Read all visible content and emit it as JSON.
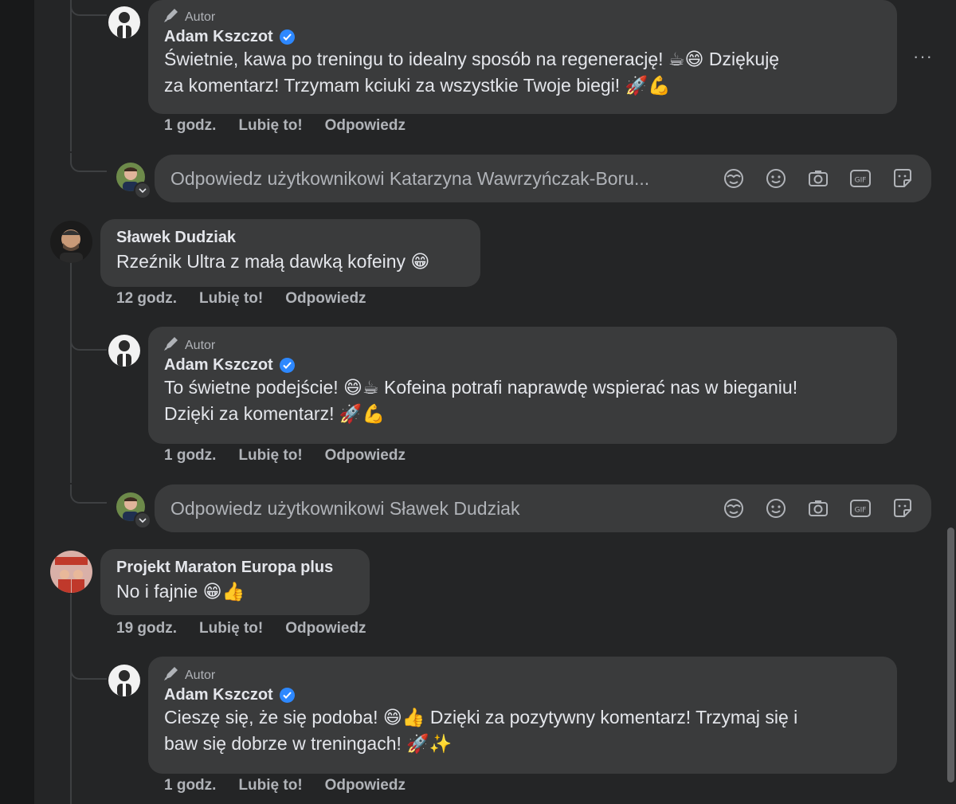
{
  "labels": {
    "author_badge": "Autor",
    "like": "Lubię to!",
    "reply": "Odpowiedz",
    "more": "···"
  },
  "thread1": {
    "reply": {
      "author": "Adam Kszczot",
      "line1": "Świetnie, kawa po treningu to idealny sposób na regenerację! ☕😄 Dziękuję",
      "line2": "za komentarz! Trzymam kciuki za wszystkie Twoje biegi! 🚀💪",
      "time": "1 godz."
    },
    "reply_box_placeholder": "Odpowiedz użytkownikowi Katarzyna Wawrzyńczak-Boru..."
  },
  "thread2": {
    "comment": {
      "author": "Sławek Dudziak",
      "text": "Rzeźnik Ultra z małą dawką kofeiny 😁",
      "time": "12 godz."
    },
    "reply": {
      "author": "Adam Kszczot",
      "line1": "To świetne podejście! 😄☕ Kofeina potrafi naprawdę wspierać nas w bieganiu!",
      "line2": "Dzięki za komentarz! 🚀💪",
      "time": "1 godz."
    },
    "reply_box_placeholder": "Odpowiedz użytkownikowi Sławek Dudziak"
  },
  "thread3": {
    "comment": {
      "author": "Projekt Maraton Europa plus",
      "text": "No i fajnie 😁👍",
      "time": "19 godz."
    },
    "reply": {
      "author": "Adam Kszczot",
      "line1": "Cieszę się, że się podoba! 😄👍 Dzięki za pozytywny komentarz! Trzymaj się i",
      "line2": "baw się dobrze w treningach! 🚀✨",
      "time": "1 godz."
    }
  },
  "colors": {
    "background": "#242526",
    "bubble": "#3a3b3c",
    "verified": "#2d88ff",
    "muted_text": "#b0b3b8"
  }
}
